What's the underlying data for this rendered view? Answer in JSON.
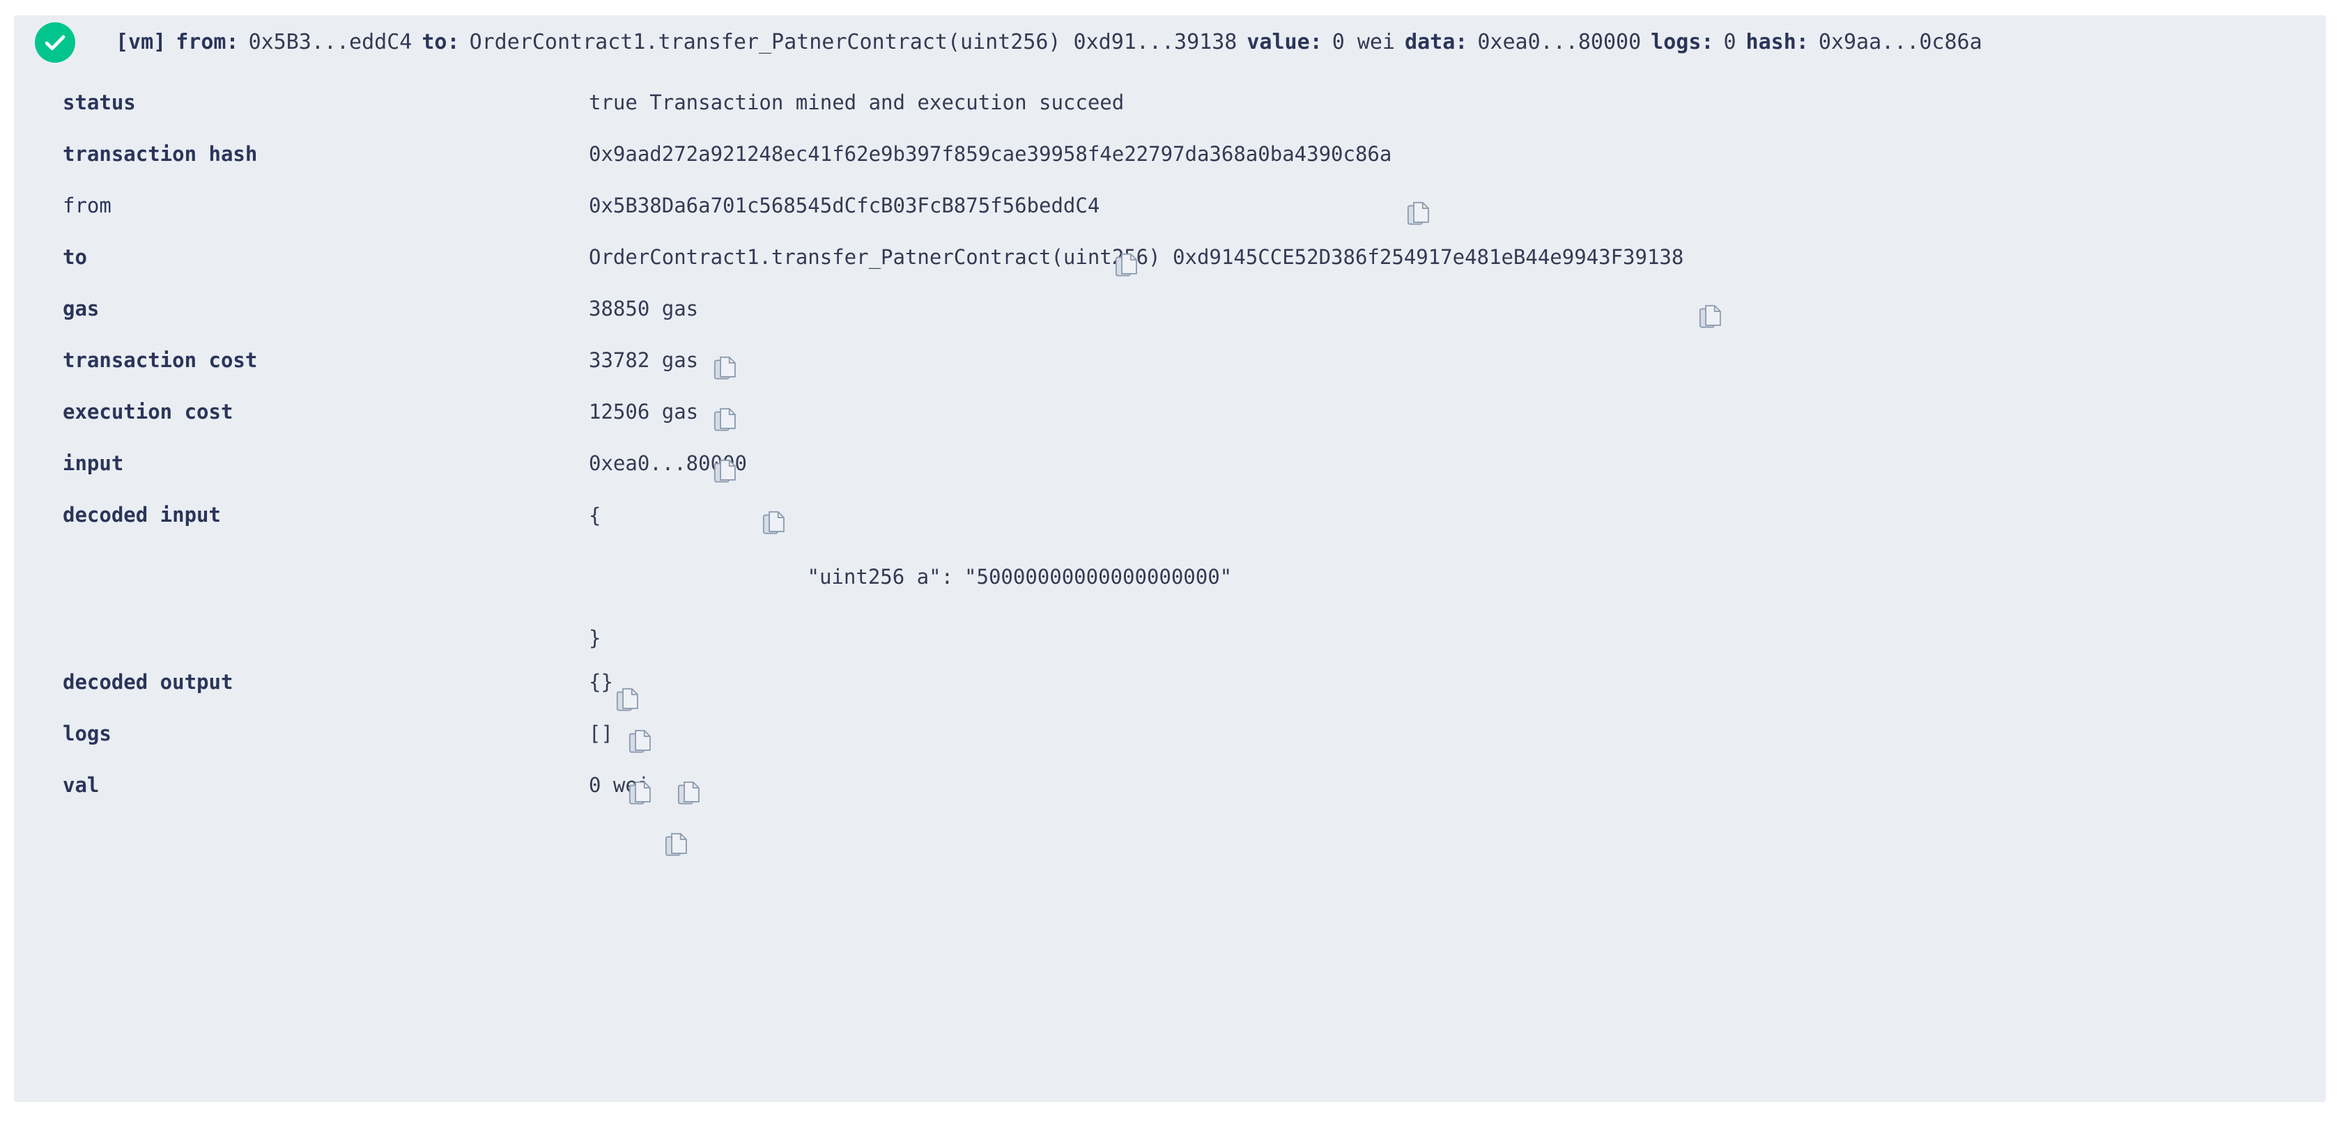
{
  "panel": {
    "status_icon": "check-circle-icon",
    "accent_success": "#02c58d",
    "background": "#eaeef3",
    "text_color": "#2b3559"
  },
  "header": {
    "vm_tag": "[vm]",
    "pairs": [
      {
        "key": "from:",
        "value": "0x5B3...eddC4"
      },
      {
        "key": "to:",
        "value": "OrderContract1.transfer_PatnerContract(uint256) 0xd91...39138"
      },
      {
        "key": "value:",
        "value": "0 wei"
      },
      {
        "key": "data:",
        "value": "0xea0...80000"
      },
      {
        "key": "logs:",
        "value": "0"
      },
      {
        "key": "hash:",
        "value": "0x9aa...0c86a"
      }
    ]
  },
  "rows": [
    {
      "label": "status",
      "bold": true,
      "value": "true Transaction mined and execution succeed",
      "copy_buttons": 0
    },
    {
      "label": "transaction hash",
      "bold": true,
      "value": "0x9aad272a921248ec41f62e9b397f859cae39958f4e22797da368a0ba4390c86a",
      "copy_buttons": 1
    },
    {
      "label": "from",
      "bold": false,
      "value": "0x5B38Da6a701c568545dCfcB03FcB875f56beddC4",
      "copy_buttons": 1
    },
    {
      "label": "to",
      "bold": true,
      "value": "OrderContract1.transfer_PatnerContract(uint256) 0xd9145CCE52D386f254917e481eB44e9943F39138",
      "copy_buttons": 1
    },
    {
      "label": "gas",
      "bold": true,
      "value": "38850 gas",
      "copy_buttons": 1
    },
    {
      "label": "transaction cost",
      "bold": true,
      "value": "33782 gas",
      "copy_buttons": 1
    },
    {
      "label": "execution cost",
      "bold": true,
      "value": "12506 gas",
      "copy_buttons": 1
    },
    {
      "label": "input",
      "bold": true,
      "value": "0xea0...80000",
      "copy_buttons": 1
    },
    {
      "label": "decoded output",
      "bold": true,
      "value": "{}",
      "copy_buttons": 1
    },
    {
      "label": "logs",
      "bold": true,
      "value": "[]",
      "copy_buttons": 2
    },
    {
      "label": "val",
      "bold": true,
      "value": "0 wei",
      "copy_buttons": 1
    }
  ],
  "decoded_input": {
    "label": "decoded input",
    "open_brace": "{",
    "entry_key": "\"uint256 a\":",
    "entry_value": "\"50000000000000000000\"",
    "close_brace": "}",
    "copy_buttons": 1
  }
}
